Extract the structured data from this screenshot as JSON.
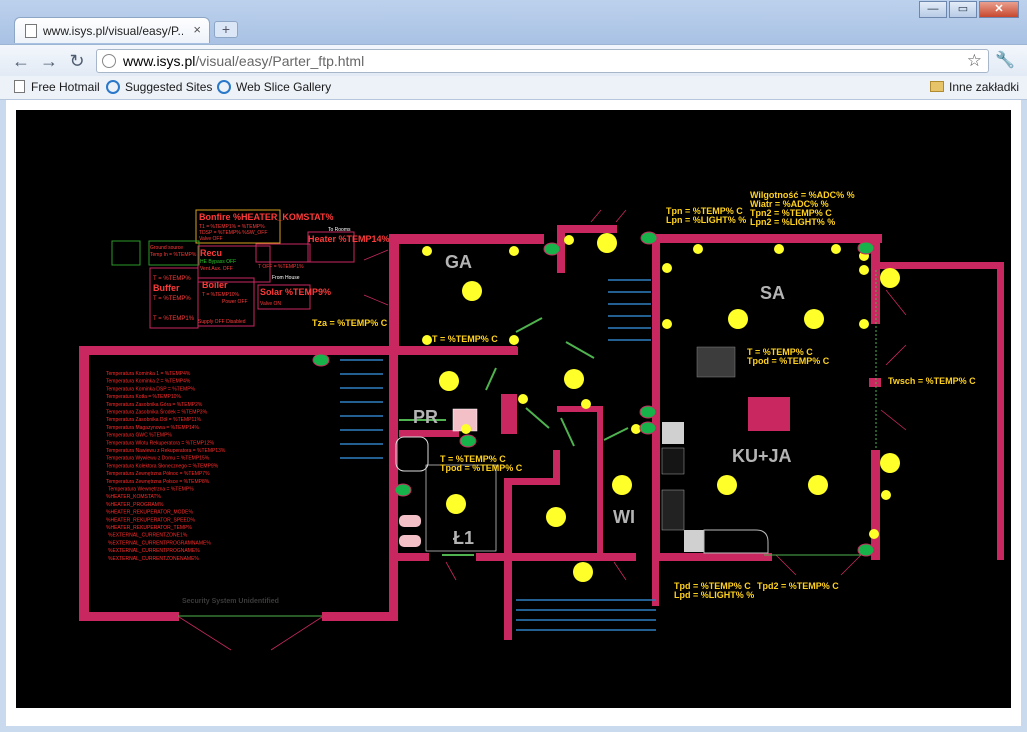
{
  "browser": {
    "tab_title": "www.isys.pl/visual/easy/P...",
    "tab_close": "×",
    "new_tab": "+",
    "url_host": "www.isys.pl",
    "url_path": "/visual/easy/Parter_ftp.html",
    "bookmarks": [
      "Free Hotmail",
      "Suggested Sites",
      "Web Slice Gallery"
    ],
    "other_bookmarks": "Inne zakładki"
  },
  "rooms": {
    "ga": "GA",
    "sa": "SA",
    "pr": "PR",
    "kuja": "KU+JA",
    "l1": "Ł1",
    "wi": "WI"
  },
  "readings": {
    "tza": "Tza = %TEMP% C",
    "t_ga": "T = %TEMP% C",
    "tpn": "Tpn = %TEMP% C",
    "lpn": "Lpn = %LIGHT% %",
    "wilg": "Wilgotność = %ADC% %",
    "wiatr": "Wiatr = %ADC% %",
    "tpn2": "Tpn2 = %TEMP% C",
    "lpn2": "Lpn2 = %LIGHT% %",
    "t_sa": "T = %TEMP% C",
    "tpod_sa": "Tpod = %TEMP% C",
    "twsch": "Twsch = %TEMP% C",
    "t_l1": "T = %TEMP% C",
    "tpod_l1": "Tpod = %TEMP% C",
    "tpd": "Tpd = %TEMP% C",
    "lpd": "Lpd = %LIGHT% %",
    "tpd2": "Tpd2 = %TEMP% C"
  },
  "heating": {
    "bonfire": "Bonfire %HEATER_KOMSTAT%",
    "bonfire_l1": "T1 = %TEMP1% = %TEMP%",
    "bonfire_l2": "TDSP = %TEMP% %SW_OFF",
    "bonfire_l3": "Valve OFF",
    "heater": "Heater %TEMP14%",
    "to_rooms": "To Rooms",
    "from_house": "From House",
    "buffer": "Buffer",
    "buffer_t1": "T = %TEMP%",
    "buffer_t2": "T = %TEMP%",
    "buffer_t3": "T = %TEMP1%",
    "boiler": "Boiler",
    "boiler_t": "T = %TEMP10%",
    "boiler_p": "Power OFF",
    "solar": "Solar %TEMP9%",
    "solar_v": "Valve ON",
    "supply": "Supply OFF   Disabled",
    "ground": "Ground source",
    "ground_l1": "Temp In = %TEMP%",
    "recu": "Recu",
    "recu_l1": "HE Bypass OFF",
    "recu_l2": "Vent.Aux. OFF",
    "tdiff": "T OFF = %TEMP1%"
  },
  "summary": {
    "lines": [
      "Temperatura Kominka 1 = %TEMP4%",
      "Temperatura Kominka 2 = %TEMP4%",
      "Temperatura Kominka DSP = %TEMP%",
      "Temperatura Kotła = %TEMP10%",
      "Temperatura Zasobnika Góra = %TEMP2%",
      "Temperatura Zasobnika Środek = %TEMP3%",
      "Temperatura Zasobnika Dół = %TEMP11%",
      "Temperatura Magazynowa = %TEMP14%",
      "Temperatura GWC %TEMP%",
      "Temperatura Wlotu Rekuperatora = %TEMP12%",
      "Temperatura Nawiewu z Rekuperatora = %TEMP13%",
      "Temperatura Wywiewu z Domu = %TEMP15%",
      "Temperatura Kolektora Słonecznego = %TEMP9%",
      "Temperatura Zewnętrzna Północ = %TEMP7%",
      "Temperatura Zewnętrzna Połsce = %TEMP8%",
      "Temperatura Wewnętrzna = %TEMP%",
      "%HEATER_KOMSTAT%",
      "%HEATER_PROGRAM%",
      "%HEATER_REKUPERATOR_MODE%",
      "%HEATER_REKUPERATOR_SPEED%",
      "%HEATER_REKUPERATOR_TEMP%",
      "%EXTERNAL_CURRENTZONE1%",
      "%EXTERNAL_CURRENTPROGRAMNAME%",
      "%EXTERNAL_CURRENTPROGNAME%",
      "%EXTERNAL_CURRENTZONENAME%"
    ],
    "security": "Security System Unidentified"
  },
  "colors": {
    "wall": "#c8285f",
    "lamp": "#ffff2a",
    "text_yellow": "#ffd21f",
    "text_red": "#ff2a2a",
    "sensor": "#18b24a",
    "room_label": "#b4b4b4",
    "stairs": "#2f7fbf"
  }
}
